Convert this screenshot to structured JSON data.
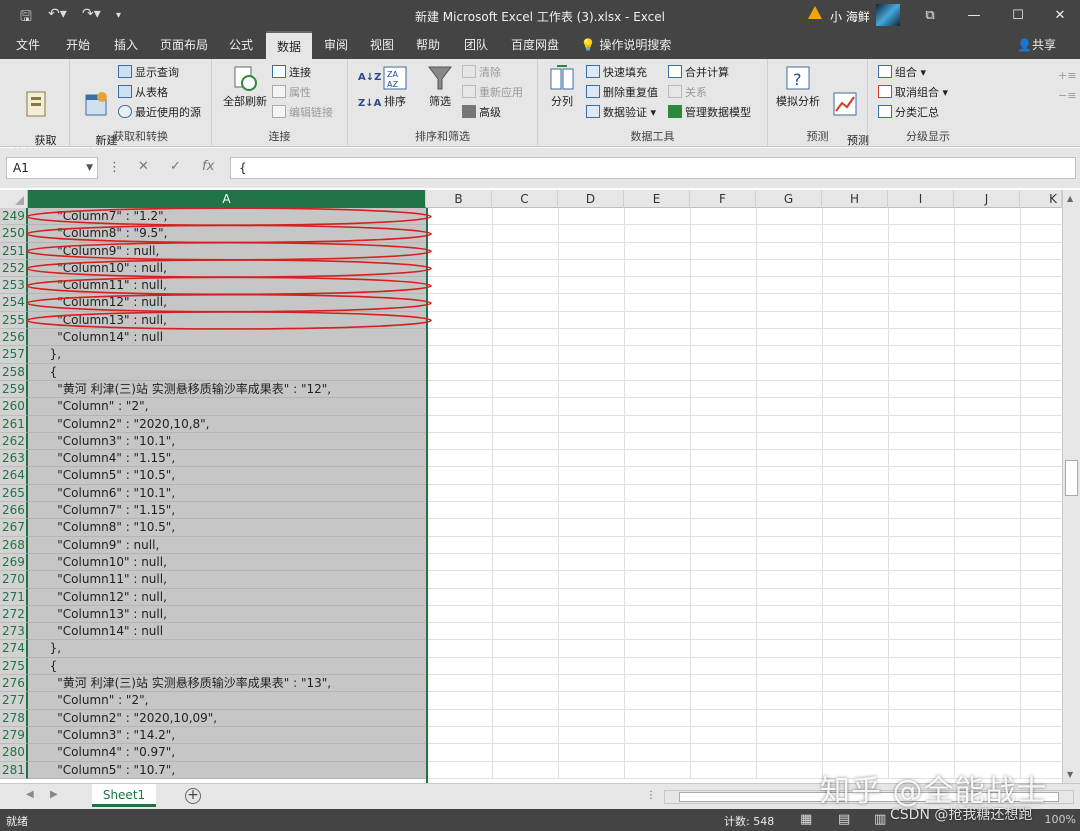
{
  "window": {
    "title": "新建 Microsoft Excel 工作表 (3).xlsx  -  Excel",
    "user": "小 海鲜",
    "controls": [
      "⧉",
      "—",
      "☐",
      "✕"
    ]
  },
  "tabs": [
    "文件",
    "开始",
    "插入",
    "页面布局",
    "公式",
    "数据",
    "审阅",
    "视图",
    "帮助",
    "团队",
    "百度网盘",
    "操作说明搜索"
  ],
  "active_tab": "数据",
  "share_label": "共享",
  "ribbon": {
    "get_external": "获取\n外部数据",
    "new_query": "新建\n查询",
    "show_queries": "显示查询",
    "from_table": "从表格",
    "recent_sources": "最近使用的源",
    "group_get": "获取和转换",
    "refresh_all": "全部刷新",
    "connections": "连接",
    "properties": "属性",
    "edit_links": "编辑链接",
    "group_connections": "连接",
    "sort_az": "A↓Z",
    "sort_za": "Z↓A",
    "sort": "排序",
    "filter": "筛选",
    "clear": "清除",
    "reapply": "重新应用",
    "advanced": "高级",
    "group_sort": "排序和筛选",
    "text_to_columns": "分列",
    "flash_fill": "快速填充",
    "remove_dups": "删除重复值",
    "data_validation": "数据验证",
    "consolidate": "合并计算",
    "relationships": "关系",
    "data_model": "管理数据模型",
    "group_tools": "数据工具",
    "what_if": "模拟分析",
    "forecast_sheet": "预测\n工作表",
    "group_forecast": "预测",
    "group_btn": "组合",
    "ungroup": "取消组合",
    "subtotal": "分类汇总",
    "group_outline": "分级显示"
  },
  "formula_bar": {
    "name_box": "A1",
    "content": "{",
    "fx": "fx"
  },
  "columns": [
    "A",
    "B",
    "C",
    "D",
    "E",
    "F",
    "G",
    "H",
    "I",
    "J",
    "K"
  ],
  "rows": [
    {
      "n": "249",
      "v": "    \"Column7\" : \"1.2\","
    },
    {
      "n": "250",
      "v": "    \"Column8\" : \"9.5\","
    },
    {
      "n": "251",
      "v": "    \"Column9\" : null,"
    },
    {
      "n": "252",
      "v": "    \"Column10\" : null,"
    },
    {
      "n": "253",
      "v": "    \"Column11\" : null,"
    },
    {
      "n": "254",
      "v": "    \"Column12\" : null,"
    },
    {
      "n": "255",
      "v": "    \"Column13\" : null,"
    },
    {
      "n": "256",
      "v": "    \"Column14\" : null"
    },
    {
      "n": "257",
      "v": "  },"
    },
    {
      "n": "258",
      "v": "  {"
    },
    {
      "n": "259",
      "v": "    \"黄河 利津(三)站 实测悬移质输沙率成果表\" : \"12\","
    },
    {
      "n": "260",
      "v": "    \"Column\" : \"2\","
    },
    {
      "n": "261",
      "v": "    \"Column2\" : \"2020,10,8\","
    },
    {
      "n": "262",
      "v": "    \"Column3\" : \"10.1\","
    },
    {
      "n": "263",
      "v": "    \"Column4\" : \"1.15\","
    },
    {
      "n": "264",
      "v": "    \"Column5\" : \"10.5\","
    },
    {
      "n": "265",
      "v": "    \"Column6\" : \"10.1\","
    },
    {
      "n": "266",
      "v": "    \"Column7\" : \"1.15\","
    },
    {
      "n": "267",
      "v": "    \"Column8\" : \"10.5\","
    },
    {
      "n": "268",
      "v": "    \"Column9\" : null,"
    },
    {
      "n": "269",
      "v": "    \"Column10\" : null,"
    },
    {
      "n": "270",
      "v": "    \"Column11\" : null,"
    },
    {
      "n": "271",
      "v": "    \"Column12\" : null,"
    },
    {
      "n": "272",
      "v": "    \"Column13\" : null,"
    },
    {
      "n": "273",
      "v": "    \"Column14\" : null"
    },
    {
      "n": "274",
      "v": "  },"
    },
    {
      "n": "275",
      "v": "  {"
    },
    {
      "n": "276",
      "v": "    \"黄河 利津(三)站 实测悬移质输沙率成果表\" : \"13\","
    },
    {
      "n": "277",
      "v": "    \"Column\" : \"2\","
    },
    {
      "n": "278",
      "v": "    \"Column2\" : \"2020,10,09\","
    },
    {
      "n": "279",
      "v": "    \"Column3\" : \"14.2\","
    },
    {
      "n": "280",
      "v": "    \"Column4\" : \"0.97\","
    },
    {
      "n": "281",
      "v": "    \"Column5\" : \"10.7\","
    }
  ],
  "annotated_rows": [
    0,
    1,
    2,
    3,
    4,
    5,
    6
  ],
  "sheet": {
    "name": "Sheet1",
    "add": "+"
  },
  "status": {
    "ready": "就绪",
    "count": "计数: 548",
    "zoom": "100%"
  },
  "watermark": {
    "main": "知乎 @全能战士",
    "sub": "CSDN @抢我糖还想跑"
  },
  "colors": {
    "accent": "#1f7346",
    "oval": "#d42020",
    "chrome": "#444444"
  }
}
